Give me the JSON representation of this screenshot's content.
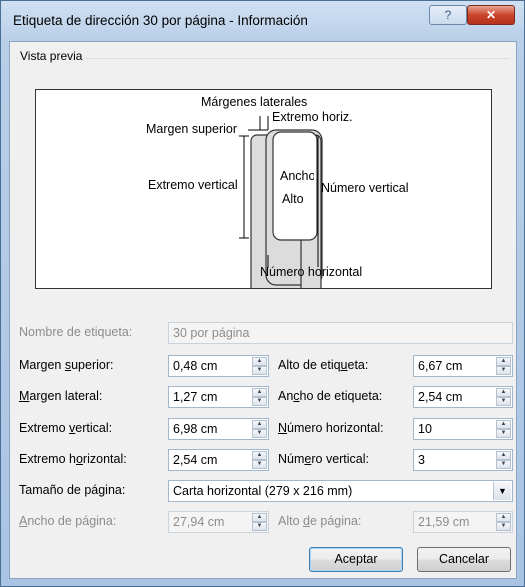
{
  "window": {
    "title": "Etiqueta de dirección 30 por página - Información",
    "help_glyph": "?",
    "close_glyph": "✕"
  },
  "preview": {
    "group_label": "Vista previa",
    "labels": {
      "margenes_laterales": "Márgenes laterales",
      "margen_superior": "Margen superior",
      "extremo_horiz": "Extremo horiz.",
      "extremo_vertical": "Extremo vertical",
      "ancho": "Ancho",
      "alto": "Alto",
      "numero_vertical": "Número vertical",
      "numero_horizontal": "Número horizontal"
    }
  },
  "form": {
    "nombre_etiqueta": {
      "label": "Nombre de etiqueta:",
      "value": "30 por página"
    },
    "margen_superior": {
      "label_pre": "Margen ",
      "label_u": "s",
      "label_post": "uperior:",
      "value": "0,48 cm"
    },
    "margen_lateral": {
      "label_pre": "",
      "label_u": "M",
      "label_post": "argen lateral:",
      "value": "1,27 cm"
    },
    "extremo_vertical": {
      "label_pre": "Extremo ",
      "label_u": "v",
      "label_post": "ertical:",
      "value": "6,98 cm"
    },
    "extremo_horizontal": {
      "label_pre": "Extremo h",
      "label_u": "o",
      "label_post": "rizontal:",
      "value": "2,54 cm"
    },
    "tamano_pagina": {
      "label": "Tamaño de página:",
      "value": "Carta horizontal (279 x 216 mm)"
    },
    "ancho_pagina": {
      "label_pre": "",
      "label_u": "A",
      "label_post": "ncho de página:",
      "value": "27,94 cm"
    },
    "alto_etiqueta": {
      "label_pre": "Alto de etiq",
      "label_u": "u",
      "label_post": "eta:",
      "value": "6,67 cm"
    },
    "ancho_etiqueta": {
      "label_pre": "An",
      "label_u": "c",
      "label_post": "ho de etiqueta:",
      "value": "2,54 cm"
    },
    "numero_horizontal": {
      "label_pre": "",
      "label_u": "N",
      "label_post": "úmero horizontal:",
      "value": "10"
    },
    "numero_vertical": {
      "label_pre": "Núm",
      "label_u": "e",
      "label_post": "ro vertical:",
      "value": "3"
    },
    "alto_pagina": {
      "label_pre": "Alto ",
      "label_u": "d",
      "label_post": "e página:",
      "value": "21,59 cm"
    }
  },
  "buttons": {
    "ok": "Aceptar",
    "cancel": "Cancelar"
  },
  "glyphs": {
    "spin_up": "▲",
    "spin_down": "▼",
    "drop": "▼"
  }
}
